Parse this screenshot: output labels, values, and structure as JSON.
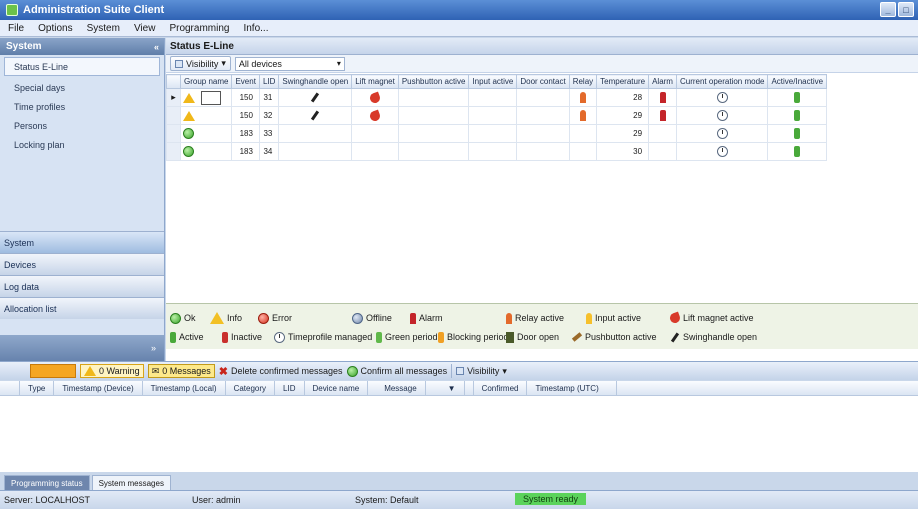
{
  "window": {
    "title": "Administration Suite Client"
  },
  "menu": [
    "File",
    "Options",
    "System",
    "View",
    "Programming",
    "Info..."
  ],
  "sidebar": {
    "header": "System",
    "items": [
      {
        "label": "Status E-Line"
      },
      {
        "label": "Special days"
      },
      {
        "label": "Time profiles"
      },
      {
        "label": "Persons"
      },
      {
        "label": "Locking plan"
      }
    ],
    "sections": [
      {
        "label": "System"
      },
      {
        "label": "Devices"
      },
      {
        "label": "Log data"
      },
      {
        "label": "Allocation list"
      }
    ]
  },
  "main": {
    "title": "Status E-Line",
    "filter": {
      "visibility_label": "Visibility",
      "selected": "All devices"
    },
    "columns": [
      "Group name",
      "Event",
      "LID",
      "Swinghandle open",
      "Lift magnet",
      "Pushbutton active",
      "Input active",
      "Door contact",
      "Relay",
      "Temperature",
      "Alarm",
      "Current operation mode",
      "Active/Inactive"
    ],
    "rows": [
      {
        "event": "150",
        "lid": "31",
        "temperature": "28"
      },
      {
        "event": "150",
        "lid": "32",
        "temperature": "29"
      },
      {
        "event": "183",
        "lid": "33",
        "temperature": "29"
      },
      {
        "event": "183",
        "lid": "34",
        "temperature": "30"
      }
    ]
  },
  "legend": {
    "row1": [
      "Ok",
      "Info",
      "Error",
      "Offline",
      "Alarm",
      "Relay active",
      "Input active",
      "Lift magnet active"
    ],
    "row2": [
      "Active",
      "Inactive",
      "Timeprofile managed",
      "Green period",
      "Blocking period",
      "Door open",
      "Pushbutton active",
      "Swinghandle open"
    ]
  },
  "messages": {
    "warning_label": "0 Warning",
    "messages_label": "0 Messages",
    "delete_label": "Delete confirmed messages",
    "confirm_label": "Confirm all messages",
    "visibility_label": "Visibility",
    "columns": [
      "Type",
      "Timestamp (Device)",
      "Timestamp (Local)",
      "Category",
      "LID",
      "Device name",
      "Message",
      "Confirmed",
      "Timestamp (UTC)"
    ]
  },
  "bottom_tabs": [
    "Programming status",
    "System messages"
  ],
  "status": {
    "server": "Server: LOCALHOST",
    "user": "User: admin",
    "system": "System: Default",
    "ready": "System ready"
  }
}
